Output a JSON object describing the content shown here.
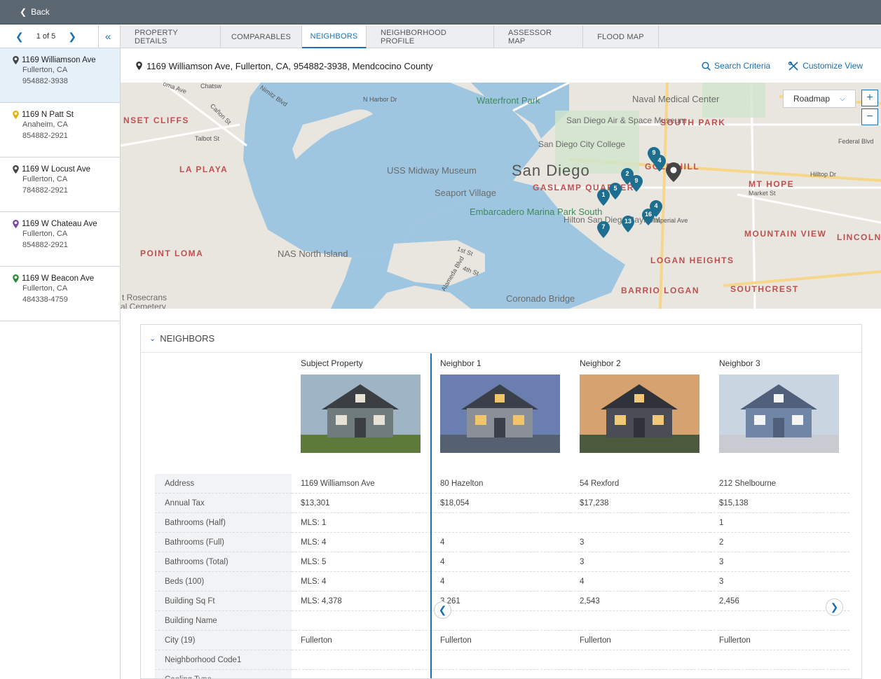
{
  "topbar": {
    "back_label": "Back"
  },
  "pager": {
    "text": "1 of 5"
  },
  "properties": [
    {
      "street": "1169 Williamson Ave",
      "city": "Fullerton, CA",
      "zip": "954882-3938",
      "pin_color": "#444444"
    },
    {
      "street": "1169 N Patt St",
      "city": "Anaheim, CA",
      "zip": "854882-2921",
      "pin_color": "#e2b007"
    },
    {
      "street": "1169 W Locust Ave",
      "city": "Fullerton, CA",
      "zip": "784882-2921",
      "pin_color": "#444444"
    },
    {
      "street": "1169 W Chateau Ave",
      "city": "Fullerton, CA",
      "zip": "854882-2921",
      "pin_color": "#7b4a9c"
    },
    {
      "street": "1169 W Beacon Ave",
      "city": "Fullerton, CA",
      "zip": "484338-4759",
      "pin_color": "#2e8a3a"
    }
  ],
  "tabs": [
    "PROPERTY DETAILS",
    "COMPARABLES",
    "NEIGHBORS",
    "NEIGHBORHOOD PROFILE",
    "ASSESSOR MAP",
    "FLOOD MAP"
  ],
  "active_tab": "NEIGHBORS",
  "address_bar": {
    "address": "1169 Williamson Ave, Fullerton, CA, 954882-3938, Mendcocino County",
    "search_criteria": "Search Criteria",
    "customize_view": "Customize View"
  },
  "map": {
    "type_select": "Roadmap",
    "zoom_in": "+",
    "zoom_out": "−",
    "labels": {
      "sunset_cliffs": "NSET CLIFFS",
      "la_playa": "LA PLAYA",
      "point_loma": "POINT LOMA",
      "nas": "NAS North Island",
      "rosecrans": "t Rosecrans",
      "cemetery": "al Cemetery",
      "midway": "USS Midway Museum",
      "seaport": "Seaport Village",
      "embarcadero": "Embarcadero Marina Park South",
      "waterfront": "Waterfront Park",
      "san_diego": "San Diego",
      "gaslamp": "GASLAMP QUARTER",
      "air_space": "San Diego Air & Space Museum",
      "city_college": "San Diego City College",
      "naval": "Naval Medical Center",
      "south_park": "SOUTH PARK",
      "golden_hill": "GOLD   HILL",
      "mt_hope": "MT HOPE",
      "market_st": "Market St",
      "mountain_view": "MOUNTAIN VIEW",
      "lincoln": "LINCOLN",
      "logan_heights": "LOGAN HEIGHTS",
      "barrio_logan": "BARRIO LOGAN",
      "southcrest": "SOUTHCREST",
      "coronado": "Coronado Bridge",
      "hilton": "Hilton San Diego Bayfront",
      "n_harbor": "N Harbor Dr",
      "hilltop": "Hilltop Dr",
      "federal": "Federal Blvd",
      "talbot": "Talbot St",
      "fourth": "4th St",
      "first": "1st St",
      "imperial": "Imperial Ave",
      "alameda": "Alameda Blvd",
      "chatsw": "Chatsw",
      "nimitz": "Nimitz Blvd",
      "curtis": "Cañon St",
      "loma": "oma Ave"
    },
    "markers": [
      "9",
      "4",
      "2",
      "9",
      "5",
      "1",
      "16",
      "4",
      "13",
      "7"
    ]
  },
  "neighbors": {
    "section_title": "NEIGHBORS",
    "row_labels": [
      "Address",
      "Annual Tax",
      "Bathrooms (Half)",
      "Bathrooms (Full)",
      "Bathrooms (Total)",
      "Beds (100)",
      "Building Sq Ft",
      "Building Name",
      "City (19)",
      "Neighborhood Code1",
      "Cooling Type"
    ],
    "columns": [
      {
        "title": "Subject Property",
        "photo": "house-subject",
        "values": [
          "1169 Williamson Ave",
          "$13,301",
          "MLS: 1",
          "MLS: 4",
          "MLS: 5",
          "MLS: 4",
          "MLS: 4,378",
          "",
          "Fullerton",
          "",
          ""
        ]
      },
      {
        "title": "Neighbor 1",
        "photo": "house-neighbor-1",
        "values": [
          "80 Hazelton",
          "$18,054",
          "",
          "4",
          "4",
          "4",
          "3,261",
          "",
          "Fullerton",
          "",
          ""
        ]
      },
      {
        "title": "Neighbor 2",
        "photo": "house-neighbor-2",
        "values": [
          "54 Rexford",
          "$17,238",
          "",
          "3",
          "3",
          "4",
          "2,543",
          "",
          "Fullerton",
          "",
          ""
        ]
      },
      {
        "title": "Neighbor 3",
        "photo": "house-neighbor-3",
        "values": [
          "212 Shelbourne",
          "$15,138",
          "1",
          "2",
          "3",
          "3",
          "2,456",
          "",
          "Fullerton",
          "",
          ""
        ]
      }
    ]
  }
}
